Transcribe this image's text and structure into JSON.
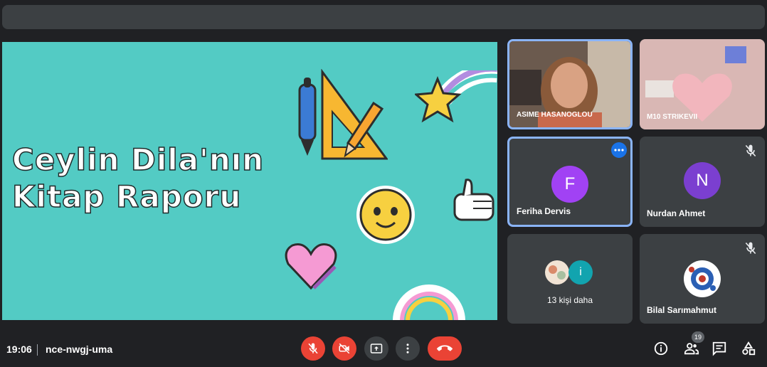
{
  "slide": {
    "title_line1": "Ceylin Dila'nın",
    "title_line2": "Kitap Raporu"
  },
  "tiles": {
    "asime": {
      "name": "ASIME HASANOGLOU"
    },
    "m10": {
      "name": "M10 STRIKEVII"
    },
    "feriha": {
      "name": "Feriha Dervis",
      "initial": "F",
      "color": "#a142f4"
    },
    "nurdan": {
      "name": "Nurdan Ahmet",
      "initial": "N",
      "color": "#7b3fd0"
    },
    "others": {
      "label": "13 kişi daha",
      "initial": "i"
    },
    "bilal": {
      "name": "Bilal Sarımahmut"
    }
  },
  "bottom_bar": {
    "time": "19:06",
    "meeting_code": "nce-nwgj-uma",
    "participants_count": "19"
  },
  "colors": {
    "accent": "#8ab4f8",
    "danger": "#ea4335",
    "slide_bg": "#53cbc4",
    "tile_bg": "#3c4043"
  }
}
